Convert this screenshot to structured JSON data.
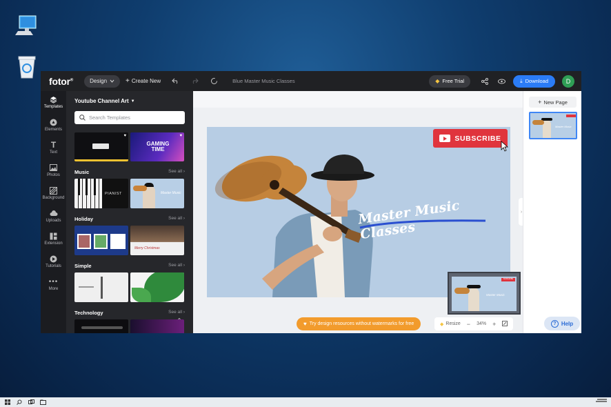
{
  "colors": {
    "accent_blue": "#2b7cf6",
    "subscribe_red": "#e0343d",
    "watermark_orange": "#f29b2c",
    "avatar_green": "#2f9f55"
  },
  "toolbar": {
    "logo": "fotor",
    "logo_mark": "®",
    "design_label": "Design",
    "create_label": "Create New",
    "doc_title": "Blue Master Music Classes",
    "free_trial_label": "Free Trial",
    "download_label": "Download",
    "avatar_initial": "D"
  },
  "rail": {
    "items": [
      {
        "label": "Templates",
        "icon": "layers-icon"
      },
      {
        "label": "Elements",
        "icon": "elements-icon"
      },
      {
        "label": "Text",
        "icon": "text-icon"
      },
      {
        "label": "Photos",
        "icon": "photos-icon"
      },
      {
        "label": "Background",
        "icon": "background-icon"
      },
      {
        "label": "Uploads",
        "icon": "upload-cloud-icon"
      },
      {
        "label": "Extension",
        "icon": "extension-icon"
      },
      {
        "label": "Tutorials",
        "icon": "play-icon"
      },
      {
        "label": "More",
        "icon": "more-dots-icon"
      }
    ]
  },
  "panel": {
    "title": "Youtube Channel Art",
    "search_placeholder": "Search Templates",
    "see_all": "See all",
    "sections": [
      {
        "label": "Music"
      },
      {
        "label": "Holiday"
      },
      {
        "label": "Simple"
      },
      {
        "label": "Technology"
      }
    ],
    "thumb_texts": {
      "gaming": "GAMING TIME",
      "pianist": "PIANIST",
      "christmas": "Merry Christmas"
    }
  },
  "canvas": {
    "subscribe_label": "SUBSCRIBE",
    "headline": "Master Music Classes",
    "watermark_text": "Try design resources without watermarks for free",
    "resize_label": "Resize",
    "zoom_level": "34%",
    "minimap_subscribe": "SUBSCRIBE"
  },
  "pages": {
    "new_page_label": "New Page",
    "help_label": "Help"
  }
}
